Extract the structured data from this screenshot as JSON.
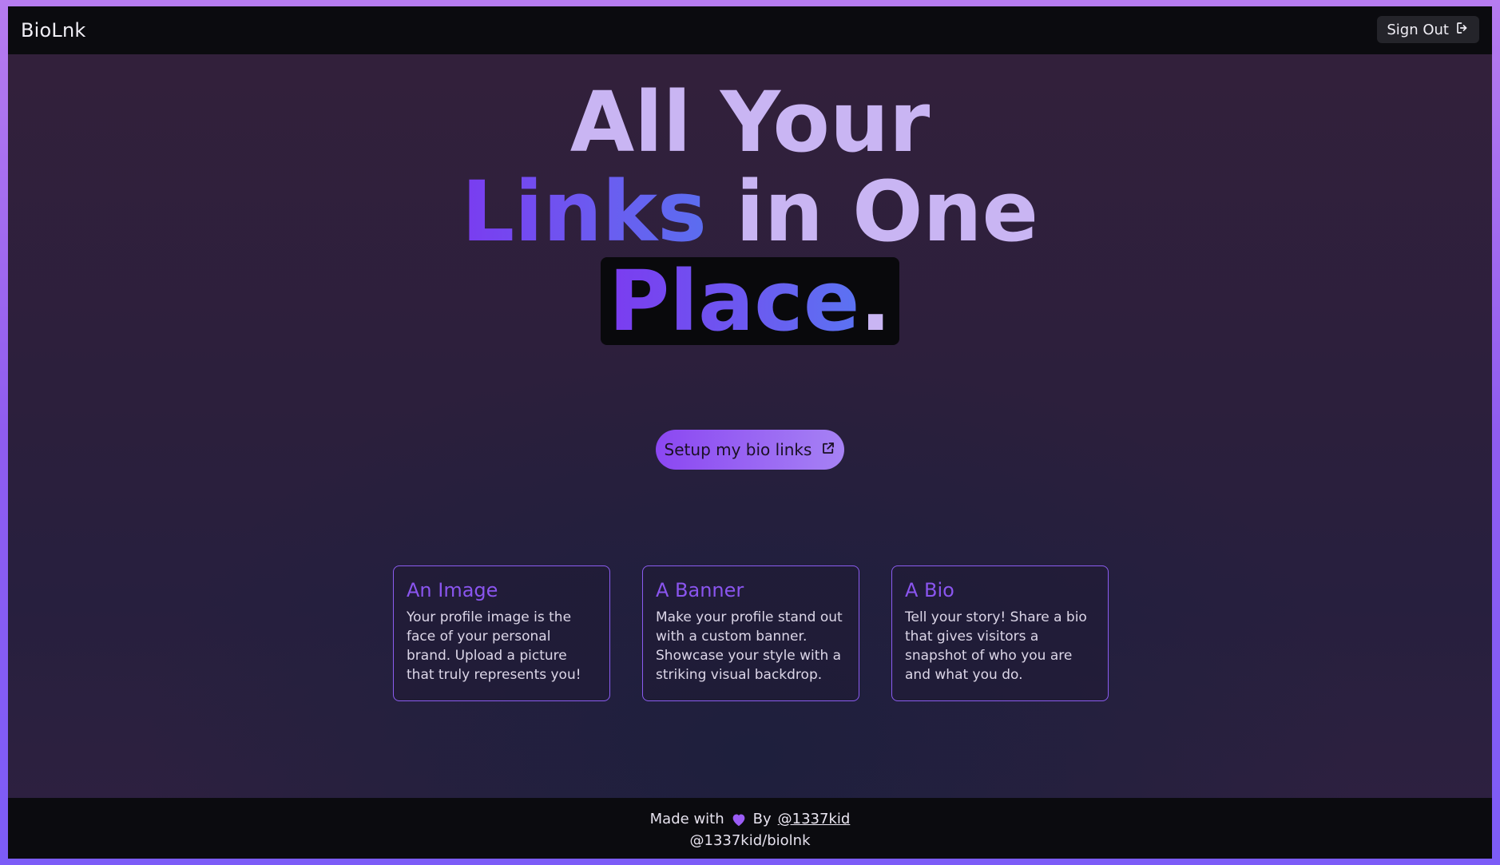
{
  "header": {
    "brand": "BioLnk",
    "sign_out_label": "Sign Out",
    "sign_out_icon": "sign-out-icon"
  },
  "hero": {
    "line1": "All Your",
    "line2_accent": "Links",
    "line2_rest": "in One",
    "line3_word": "Place",
    "line3_dot": "."
  },
  "cta": {
    "label": "Setup my bio links",
    "icon": "external-link-icon"
  },
  "cards": [
    {
      "title": "An Image",
      "body": "Your profile image is the face of your personal brand. Upload a picture that truly represents you!"
    },
    {
      "title": "A Banner",
      "body": "Make your profile stand out with a custom banner. Showcase your style with a striking visual backdrop."
    },
    {
      "title": "A Bio",
      "body": "Tell your story! Share a bio that gives visitors a snapshot of who you are and what you do."
    }
  ],
  "footer": {
    "made_with": "Made with",
    "heart_icon": "heart-icon",
    "by": "By",
    "author_handle": "@1337kid",
    "repo": "@1337kid/biolnk"
  },
  "colors": {
    "accent": "#8b5cf0",
    "hero_text": "#c9b5f3",
    "background": "#2c1f3c",
    "bar": "#0b0b0f"
  }
}
